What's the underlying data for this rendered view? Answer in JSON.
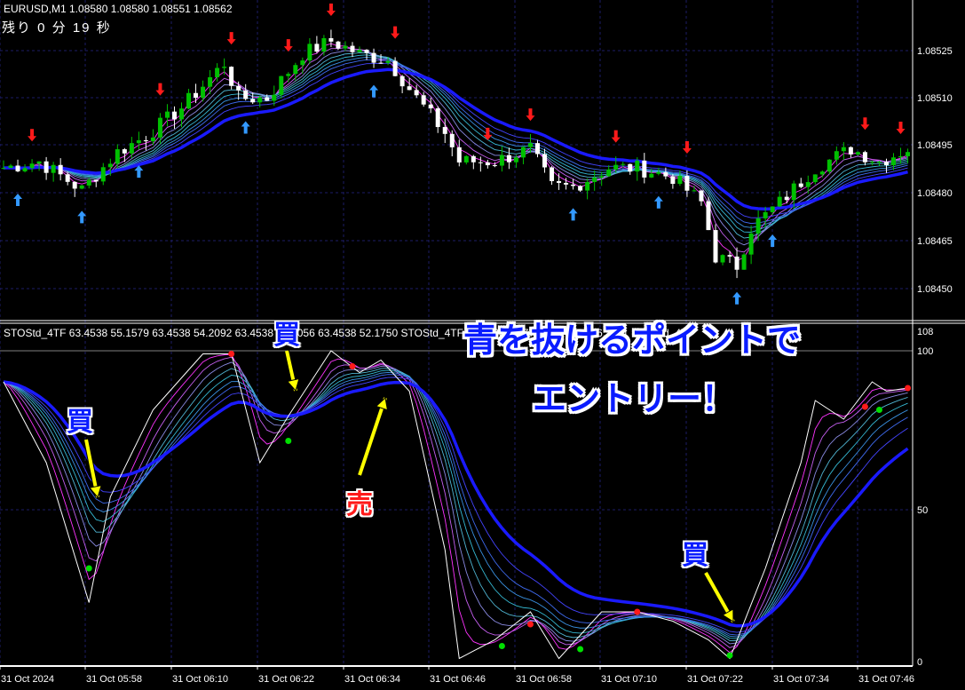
{
  "header": {
    "symbol_line": "EURUSD,M1  1.08580 1.08580 1.08551 1.08562",
    "timer": "残り 0 分 19 秒"
  },
  "indicator_label": "STOStd_4TF 63.4538 55.1579 63.4538 54.2092 63.4538 53.2056 63.4538 52.1750  STOStd_4TF 63.4538 57.7777 63.4538 56.3011  STOStd_4TF",
  "annotations": {
    "buy1": "買",
    "buy2": "買",
    "sell": "売",
    "buy3": "買",
    "headline1": "青を抜けるポイントで",
    "headline2": "エントリー！"
  },
  "colors": {
    "bull": "#00c000",
    "bear": "#ffffff",
    "ribbon_hot": "#ff33ff",
    "ribbon_cool": "#33cccc",
    "ribbon_base": "#1a1aff",
    "grid": "#1c1c66",
    "arrow": "#ffff00"
  },
  "chart_data": [
    {
      "type": "candlestick",
      "title": "EURUSD,M1",
      "ylim": [
        1.08442,
        1.08545
      ],
      "yticks": [
        "1.08525",
        "1.08510",
        "1.08495",
        "1.08480",
        "1.08465",
        "1.08450"
      ],
      "xticks": [
        "31 Oct 2024",
        "31 Oct 05:58",
        "31 Oct 06:10",
        "31 Oct 06:22",
        "31 Oct 06:34",
        "31 Oct 06:46",
        "31 Oct 06:58",
        "31 Oct 07:10",
        "31 Oct 07:22",
        "31 Oct 07:34",
        "31 Oct 07:46"
      ],
      "close_keypoints": [
        [
          0,
          1.08488
        ],
        [
          5,
          1.0849
        ],
        [
          11,
          1.08481
        ],
        [
          16,
          1.08493
        ],
        [
          20,
          1.08498
        ],
        [
          25,
          1.08507
        ],
        [
          31,
          1.08521
        ],
        [
          33,
          1.0851
        ],
        [
          37,
          1.0851
        ],
        [
          42,
          1.08524
        ],
        [
          46,
          1.08528
        ],
        [
          50,
          1.08524
        ],
        [
          54,
          1.08522
        ],
        [
          58,
          1.0851
        ],
        [
          62,
          1.08499
        ],
        [
          64,
          1.0849
        ],
        [
          69,
          1.0849
        ],
        [
          74,
          1.08494
        ],
        [
          77,
          1.08482
        ],
        [
          80,
          1.08482
        ],
        [
          85,
          1.08488
        ],
        [
          89,
          1.08488
        ],
        [
          94,
          1.08485
        ],
        [
          98,
          1.08477
        ],
        [
          100,
          1.0846
        ],
        [
          103,
          1.08457
        ],
        [
          105,
          1.08469
        ],
        [
          109,
          1.08477
        ],
        [
          114,
          1.08488
        ],
        [
          119,
          1.08494
        ],
        [
          123,
          1.0849
        ],
        [
          127,
          1.08494
        ]
      ]
    },
    {
      "type": "line",
      "title": "STOStd_4TF",
      "ylim": [
        0,
        108
      ],
      "yticks": [
        "108",
        "100",
        "50",
        "0"
      ],
      "main_keypoints": [
        [
          0,
          90
        ],
        [
          6,
          64
        ],
        [
          12,
          19
        ],
        [
          15,
          53
        ],
        [
          21,
          81
        ],
        [
          28,
          99
        ],
        [
          32,
          99
        ],
        [
          36,
          64
        ],
        [
          40,
          79
        ],
        [
          46,
          100
        ],
        [
          50,
          93
        ],
        [
          53,
          97
        ],
        [
          57,
          87
        ],
        [
          62,
          36
        ],
        [
          64,
          1
        ],
        [
          69,
          7
        ],
        [
          74,
          16
        ],
        [
          78,
          1
        ],
        [
          84,
          16
        ],
        [
          89,
          16
        ],
        [
          94,
          13
        ],
        [
          99,
          7
        ],
        [
          102,
          1
        ],
        [
          107,
          30
        ],
        [
          112,
          64
        ],
        [
          114,
          84
        ],
        [
          118,
          78
        ],
        [
          122,
          90
        ],
        [
          124,
          87
        ],
        [
          127,
          88
        ]
      ],
      "dots": [
        {
          "bar": 12,
          "value": 30,
          "color": "green"
        },
        {
          "bar": 40,
          "value": 71,
          "color": "green"
        },
        {
          "bar": 70,
          "value": 5,
          "color": "green"
        },
        {
          "bar": 81,
          "value": 4,
          "color": "green"
        },
        {
          "bar": 102,
          "value": 2,
          "color": "green"
        },
        {
          "bar": 123,
          "value": 81,
          "color": "green"
        },
        {
          "bar": 32,
          "value": 99,
          "color": "red"
        },
        {
          "bar": 49,
          "value": 95,
          "color": "red"
        },
        {
          "bar": 74,
          "value": 12,
          "color": "red"
        },
        {
          "bar": 89,
          "value": 16,
          "color": "red"
        },
        {
          "bar": 121,
          "value": 82,
          "color": "red"
        },
        {
          "bar": 127,
          "value": 88,
          "color": "red"
        }
      ]
    }
  ]
}
